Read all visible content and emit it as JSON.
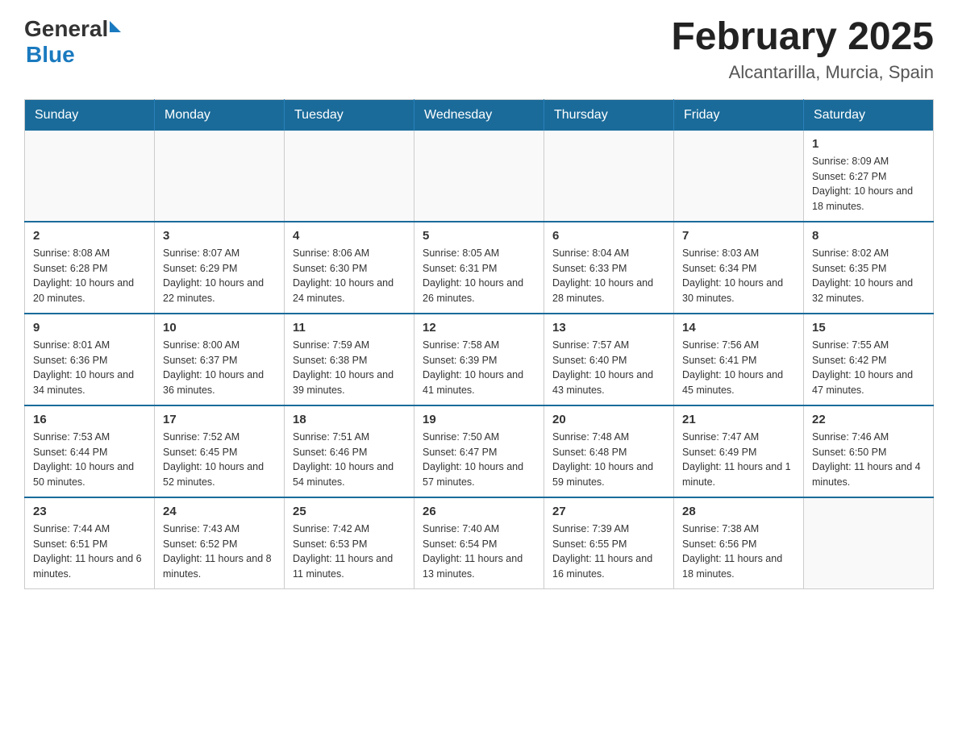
{
  "header": {
    "logo_general": "General",
    "logo_blue": "Blue",
    "title": "February 2025",
    "subtitle": "Alcantarilla, Murcia, Spain"
  },
  "weekdays": [
    "Sunday",
    "Monday",
    "Tuesday",
    "Wednesday",
    "Thursday",
    "Friday",
    "Saturday"
  ],
  "weeks": [
    [
      {
        "day": "",
        "info": ""
      },
      {
        "day": "",
        "info": ""
      },
      {
        "day": "",
        "info": ""
      },
      {
        "day": "",
        "info": ""
      },
      {
        "day": "",
        "info": ""
      },
      {
        "day": "",
        "info": ""
      },
      {
        "day": "1",
        "info": "Sunrise: 8:09 AM\nSunset: 6:27 PM\nDaylight: 10 hours and 18 minutes."
      }
    ],
    [
      {
        "day": "2",
        "info": "Sunrise: 8:08 AM\nSunset: 6:28 PM\nDaylight: 10 hours and 20 minutes."
      },
      {
        "day": "3",
        "info": "Sunrise: 8:07 AM\nSunset: 6:29 PM\nDaylight: 10 hours and 22 minutes."
      },
      {
        "day": "4",
        "info": "Sunrise: 8:06 AM\nSunset: 6:30 PM\nDaylight: 10 hours and 24 minutes."
      },
      {
        "day": "5",
        "info": "Sunrise: 8:05 AM\nSunset: 6:31 PM\nDaylight: 10 hours and 26 minutes."
      },
      {
        "day": "6",
        "info": "Sunrise: 8:04 AM\nSunset: 6:33 PM\nDaylight: 10 hours and 28 minutes."
      },
      {
        "day": "7",
        "info": "Sunrise: 8:03 AM\nSunset: 6:34 PM\nDaylight: 10 hours and 30 minutes."
      },
      {
        "day": "8",
        "info": "Sunrise: 8:02 AM\nSunset: 6:35 PM\nDaylight: 10 hours and 32 minutes."
      }
    ],
    [
      {
        "day": "9",
        "info": "Sunrise: 8:01 AM\nSunset: 6:36 PM\nDaylight: 10 hours and 34 minutes."
      },
      {
        "day": "10",
        "info": "Sunrise: 8:00 AM\nSunset: 6:37 PM\nDaylight: 10 hours and 36 minutes."
      },
      {
        "day": "11",
        "info": "Sunrise: 7:59 AM\nSunset: 6:38 PM\nDaylight: 10 hours and 39 minutes."
      },
      {
        "day": "12",
        "info": "Sunrise: 7:58 AM\nSunset: 6:39 PM\nDaylight: 10 hours and 41 minutes."
      },
      {
        "day": "13",
        "info": "Sunrise: 7:57 AM\nSunset: 6:40 PM\nDaylight: 10 hours and 43 minutes."
      },
      {
        "day": "14",
        "info": "Sunrise: 7:56 AM\nSunset: 6:41 PM\nDaylight: 10 hours and 45 minutes."
      },
      {
        "day": "15",
        "info": "Sunrise: 7:55 AM\nSunset: 6:42 PM\nDaylight: 10 hours and 47 minutes."
      }
    ],
    [
      {
        "day": "16",
        "info": "Sunrise: 7:53 AM\nSunset: 6:44 PM\nDaylight: 10 hours and 50 minutes."
      },
      {
        "day": "17",
        "info": "Sunrise: 7:52 AM\nSunset: 6:45 PM\nDaylight: 10 hours and 52 minutes."
      },
      {
        "day": "18",
        "info": "Sunrise: 7:51 AM\nSunset: 6:46 PM\nDaylight: 10 hours and 54 minutes."
      },
      {
        "day": "19",
        "info": "Sunrise: 7:50 AM\nSunset: 6:47 PM\nDaylight: 10 hours and 57 minutes."
      },
      {
        "day": "20",
        "info": "Sunrise: 7:48 AM\nSunset: 6:48 PM\nDaylight: 10 hours and 59 minutes."
      },
      {
        "day": "21",
        "info": "Sunrise: 7:47 AM\nSunset: 6:49 PM\nDaylight: 11 hours and 1 minute."
      },
      {
        "day": "22",
        "info": "Sunrise: 7:46 AM\nSunset: 6:50 PM\nDaylight: 11 hours and 4 minutes."
      }
    ],
    [
      {
        "day": "23",
        "info": "Sunrise: 7:44 AM\nSunset: 6:51 PM\nDaylight: 11 hours and 6 minutes."
      },
      {
        "day": "24",
        "info": "Sunrise: 7:43 AM\nSunset: 6:52 PM\nDaylight: 11 hours and 8 minutes."
      },
      {
        "day": "25",
        "info": "Sunrise: 7:42 AM\nSunset: 6:53 PM\nDaylight: 11 hours and 11 minutes."
      },
      {
        "day": "26",
        "info": "Sunrise: 7:40 AM\nSunset: 6:54 PM\nDaylight: 11 hours and 13 minutes."
      },
      {
        "day": "27",
        "info": "Sunrise: 7:39 AM\nSunset: 6:55 PM\nDaylight: 11 hours and 16 minutes."
      },
      {
        "day": "28",
        "info": "Sunrise: 7:38 AM\nSunset: 6:56 PM\nDaylight: 11 hours and 18 minutes."
      },
      {
        "day": "",
        "info": ""
      }
    ]
  ]
}
